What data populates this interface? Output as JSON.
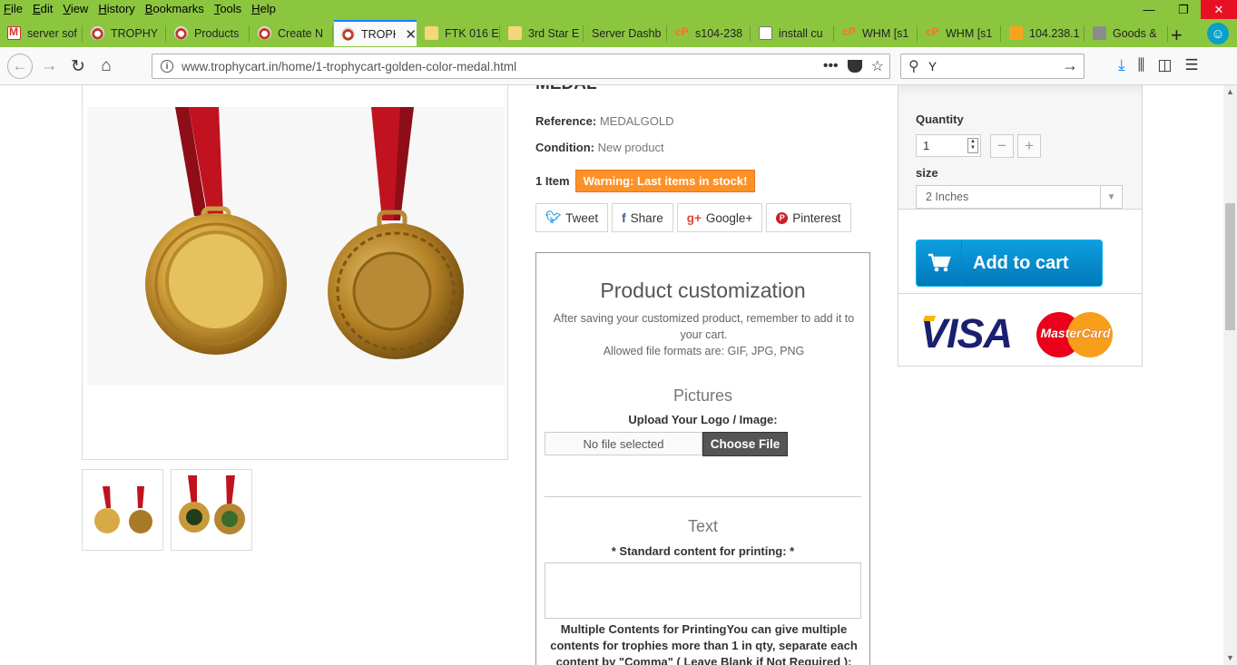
{
  "menubar": {
    "items": [
      "File",
      "Edit",
      "View",
      "History",
      "Bookmarks",
      "Tools",
      "Help"
    ],
    "minimize": "—",
    "restore": "❐",
    "close": "✕"
  },
  "tabs": [
    {
      "label": "server sof",
      "favicon": "gmail-icon"
    },
    {
      "label": "TROPHY",
      "favicon": "trophy-icon"
    },
    {
      "label": "Products",
      "favicon": "trophy-icon"
    },
    {
      "label": "Create N",
      "favicon": "trophy-icon"
    },
    {
      "label": "TROPH",
      "favicon": "trophy-icon",
      "active": true
    },
    {
      "label": "FTK 016 E",
      "favicon": "ftk-icon"
    },
    {
      "label": "3rd Star E",
      "favicon": "ftk-icon"
    },
    {
      "label": "Server Dashb",
      "favicon": ""
    },
    {
      "label": "s104-238",
      "favicon": "cpanel-icon"
    },
    {
      "label": "install cu",
      "favicon": "doc-icon"
    },
    {
      "label": "WHM [s1",
      "favicon": "cpanel-icon"
    },
    {
      "label": "WHM [s1",
      "favicon": "cpanel-icon"
    },
    {
      "label": "104.238.1",
      "favicon": "phpmyadmin-icon"
    },
    {
      "label": "Goods &",
      "favicon": "goods-icon"
    }
  ],
  "toolbar": {
    "url": "www.trophycart.in/home/1-trophycart-golden-color-medal.html",
    "search_value": "Y",
    "new_tab": "+"
  },
  "product": {
    "title_fragment": "MEDAL",
    "reference_label": "Reference:",
    "reference_value": "MEDALGOLD",
    "condition_label": "Condition:",
    "condition_value": "New product",
    "quantity_in_stock": "1 Item",
    "stock_warning": "Warning: Last items in stock!"
  },
  "social": {
    "tweet": "Tweet",
    "share": "Share",
    "google": "Google+",
    "pinterest": "Pinterest"
  },
  "customization": {
    "title": "Product customization",
    "note_line1": "After saving your customized product, remember to add it to your cart.",
    "note_line2": "Allowed file formats are: GIF, JPG, PNG",
    "pictures_title": "Pictures",
    "upload_label": "Upload Your Logo / Image:",
    "file_placeholder": "No file selected",
    "choose_file": "Choose File",
    "text_title": "Text",
    "standard_label": "* Standard content for printing: *",
    "multi_label": "Multiple Contents for PrintingYou can give multiple contents for trophies more than 1 in qty, separate each content by \"Comma\" ( Leave Blank if Not Required ):"
  },
  "buy_box": {
    "quantity_label": "Quantity",
    "quantity_value": "1",
    "size_label": "size",
    "size_value": "2 Inches",
    "add_to_cart": "Add to cart",
    "visa": "VISA",
    "mastercard": "MasterCard"
  },
  "colors": {
    "chrome_green": "#8cc63f",
    "stock_warning": "#fe9126",
    "cart_blue": "#0079b9",
    "active_tab_accent": "#0a84ff"
  }
}
